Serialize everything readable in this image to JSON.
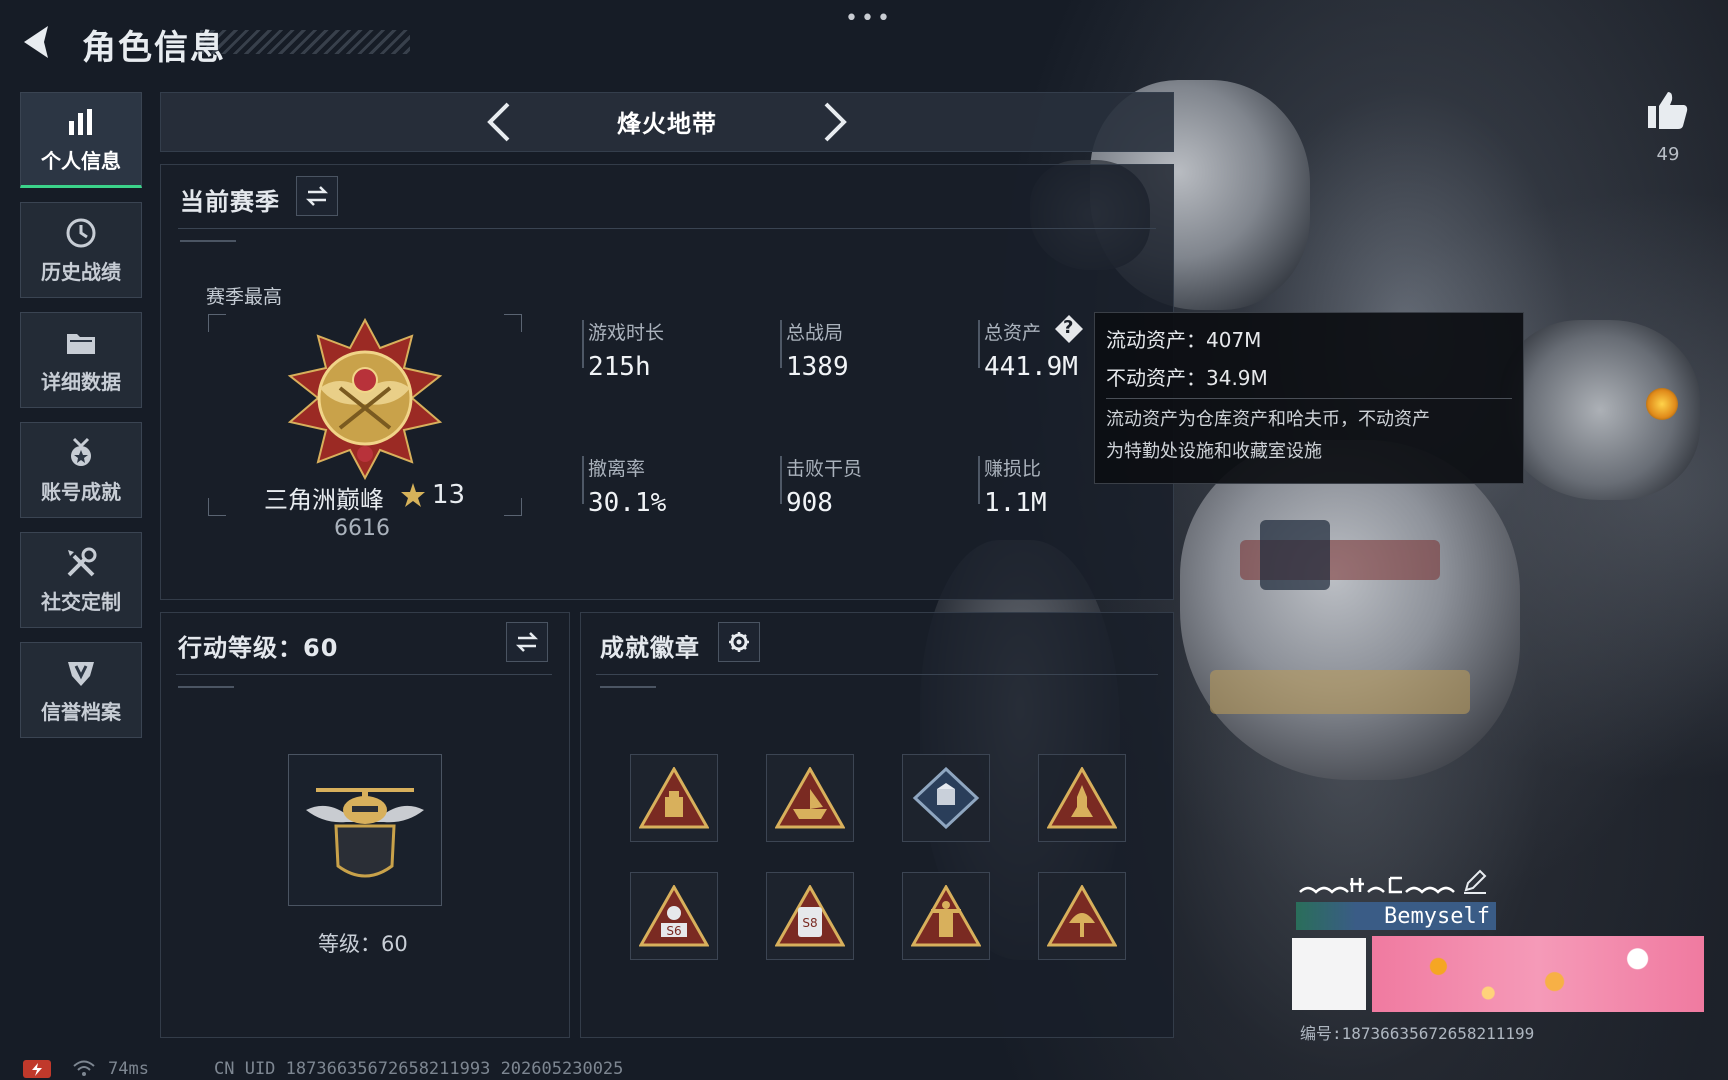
{
  "header": {
    "title": "角色信息",
    "more_dots": "•••"
  },
  "like": {
    "count": "49"
  },
  "sidebar": {
    "items": [
      {
        "label": "个人信息",
        "icon": "bar-chart-icon",
        "active": true
      },
      {
        "label": "历史战绩",
        "icon": "history-clock-icon",
        "active": false
      },
      {
        "label": "详细数据",
        "icon": "folder-icon",
        "active": false
      },
      {
        "label": "账号成就",
        "icon": "medal-icon",
        "active": false
      },
      {
        "label": "社交定制",
        "icon": "tools-icon",
        "active": false
      },
      {
        "label": "信誉档案",
        "icon": "shield-icon",
        "active": false
      }
    ]
  },
  "mode": {
    "title": "烽火地带"
  },
  "season": {
    "title": "当前赛季",
    "best_label": "赛季最高",
    "rank_name": "三角洲巅峰",
    "rank_stars": "13",
    "rank_score": "6616",
    "stats": [
      {
        "label": "游戏时长",
        "value": "215h"
      },
      {
        "label": "总战局",
        "value": "1389"
      },
      {
        "label": "总资产",
        "value": "441.9M"
      },
      {
        "label": "撤离率",
        "value": "30.1%"
      },
      {
        "label": "击败干员",
        "value": "908"
      },
      {
        "label": "赚损比",
        "value": "1.1M"
      }
    ],
    "help_glyph": "?"
  },
  "tooltip": {
    "liquid": "流动资产：407M",
    "fixed": "不动资产：34.9M",
    "desc_line1": "流动资产为仓库资产和哈夫币，不动资产",
    "desc_line2": "为特勤处设施和收藏室设施"
  },
  "action_level": {
    "title": "行动等级：60",
    "level_text": "等级：60"
  },
  "badges": {
    "title": "成就徽章",
    "items": [
      {
        "icon": "backpack-badge-icon"
      },
      {
        "icon": "boat-badge-icon"
      },
      {
        "icon": "diamond-crate-badge-icon"
      },
      {
        "icon": "rocket-badge-icon"
      },
      {
        "icon": "s6-badge-icon",
        "text": "S6"
      },
      {
        "icon": "s8-badge-icon",
        "text": "S8"
      },
      {
        "icon": "tower-badge-icon"
      },
      {
        "icon": "radar-badge-icon"
      }
    ]
  },
  "profile_card": {
    "id_label": "Bemyself",
    "uid_line": "编号:18736635672658211199"
  },
  "status_bar": {
    "ping": "74ms",
    "uid_info": "CN UID 18736635672658211993 202605230025"
  },
  "colors": {
    "accent_green": "#3bd38a",
    "gold": "#c9a24a",
    "panel_bg": "#181f2a"
  }
}
